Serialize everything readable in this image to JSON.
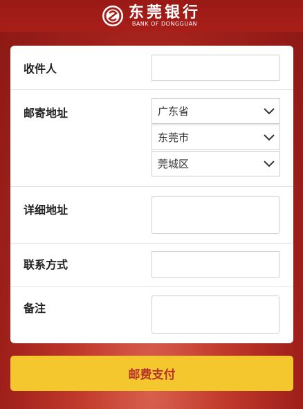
{
  "header": {
    "bank_name_cn": "东莞银行",
    "bank_name_en": "BANK OF DONGGUAN",
    "logo_icon": "bank-of-dongguan-logo"
  },
  "form": {
    "recipient": {
      "label": "收件人",
      "value": ""
    },
    "mailing_address": {
      "label": "邮寄地址",
      "province": "广东省",
      "city": "东莞市",
      "district": "莞城区"
    },
    "detailed_address": {
      "label": "详细地址",
      "value": ""
    },
    "contact": {
      "label": "联系方式",
      "value": ""
    },
    "remarks": {
      "label": "备注",
      "value": ""
    }
  },
  "actions": {
    "pay_label": "邮费支付"
  },
  "colors": {
    "header": "#a81e19",
    "background": "#c0392b",
    "button": "#f4c72f",
    "button_text": "#b8312a"
  }
}
